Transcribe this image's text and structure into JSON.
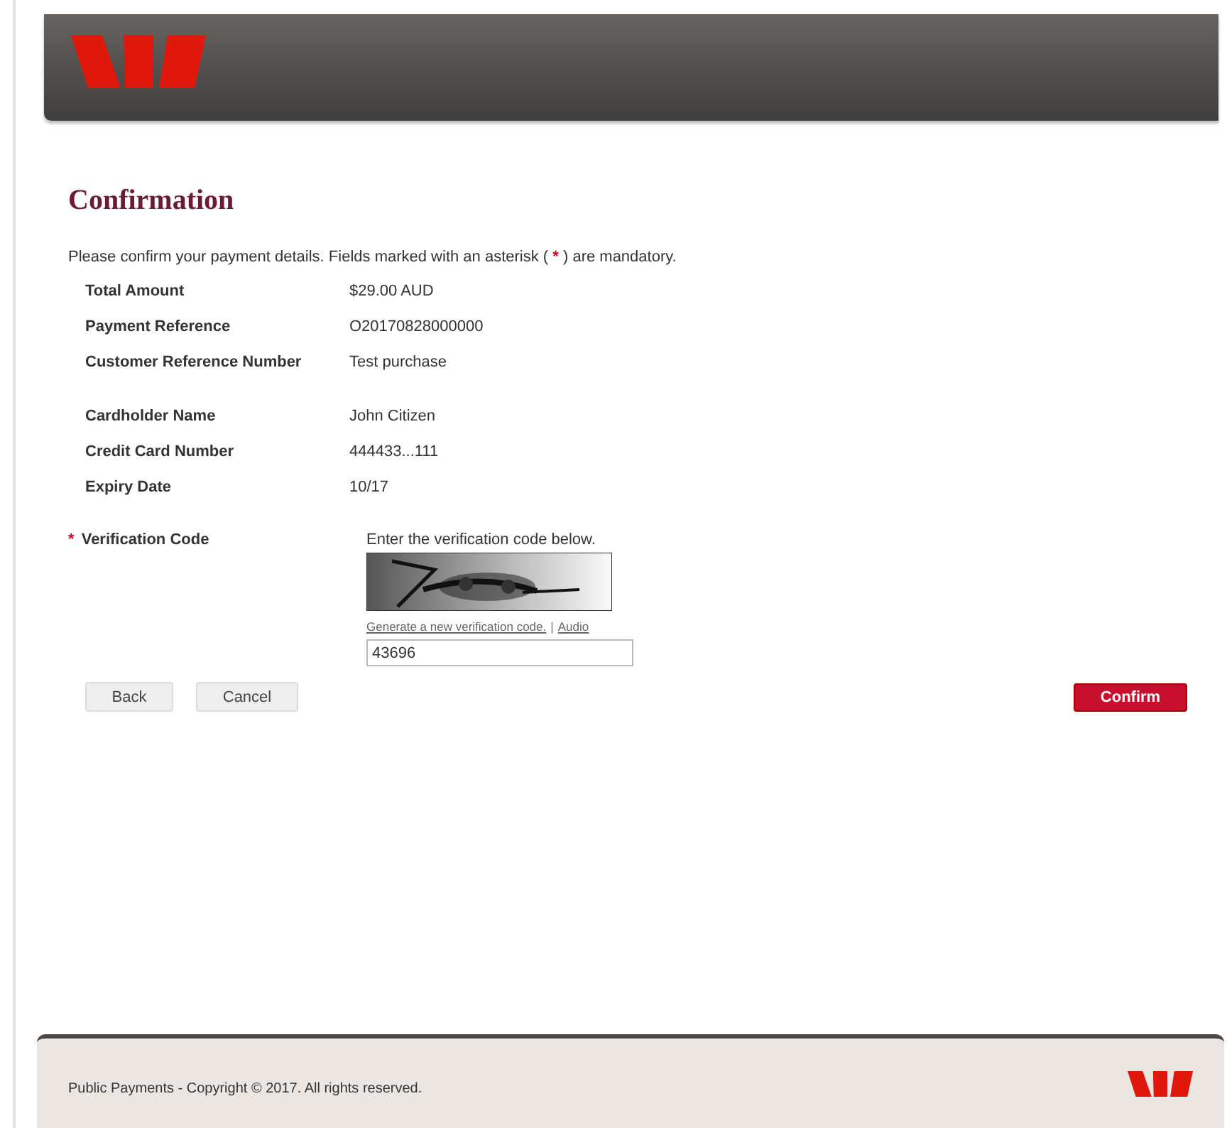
{
  "title": "Confirmation",
  "intro": {
    "before": "Please confirm your payment details. Fields marked with an asterisk (",
    "mark": "*",
    "after": ") are mandatory."
  },
  "detail_groups": [
    {
      "rows": [
        {
          "label": "Total Amount",
          "value": "$29.00 AUD"
        },
        {
          "label": "Payment Reference",
          "value": "O20170828000000"
        },
        {
          "label": "Customer Reference Number",
          "value": "Test purchase"
        }
      ]
    },
    {
      "rows": [
        {
          "label": "Cardholder Name",
          "value": "John Citizen"
        },
        {
          "label": "Credit Card Number",
          "value": "444433...111"
        },
        {
          "label": "Expiry Date",
          "value": "10/17"
        }
      ]
    }
  ],
  "verification": {
    "mark": "*",
    "label": "Verification Code",
    "instruction": "Enter the verification code below.",
    "links": [
      {
        "text": "Generate a new verification code."
      },
      {
        "text": "Audio"
      }
    ],
    "separator": "|",
    "value": "43696"
  },
  "buttons": [
    {
      "label": "Back",
      "kind": "secondary"
    },
    {
      "label": "Cancel",
      "kind": "secondary"
    },
    {
      "label": "Confirm",
      "kind": "primary"
    }
  ],
  "footer": {
    "text": "Public Payments - Copyright © 2017. All rights reserved."
  }
}
